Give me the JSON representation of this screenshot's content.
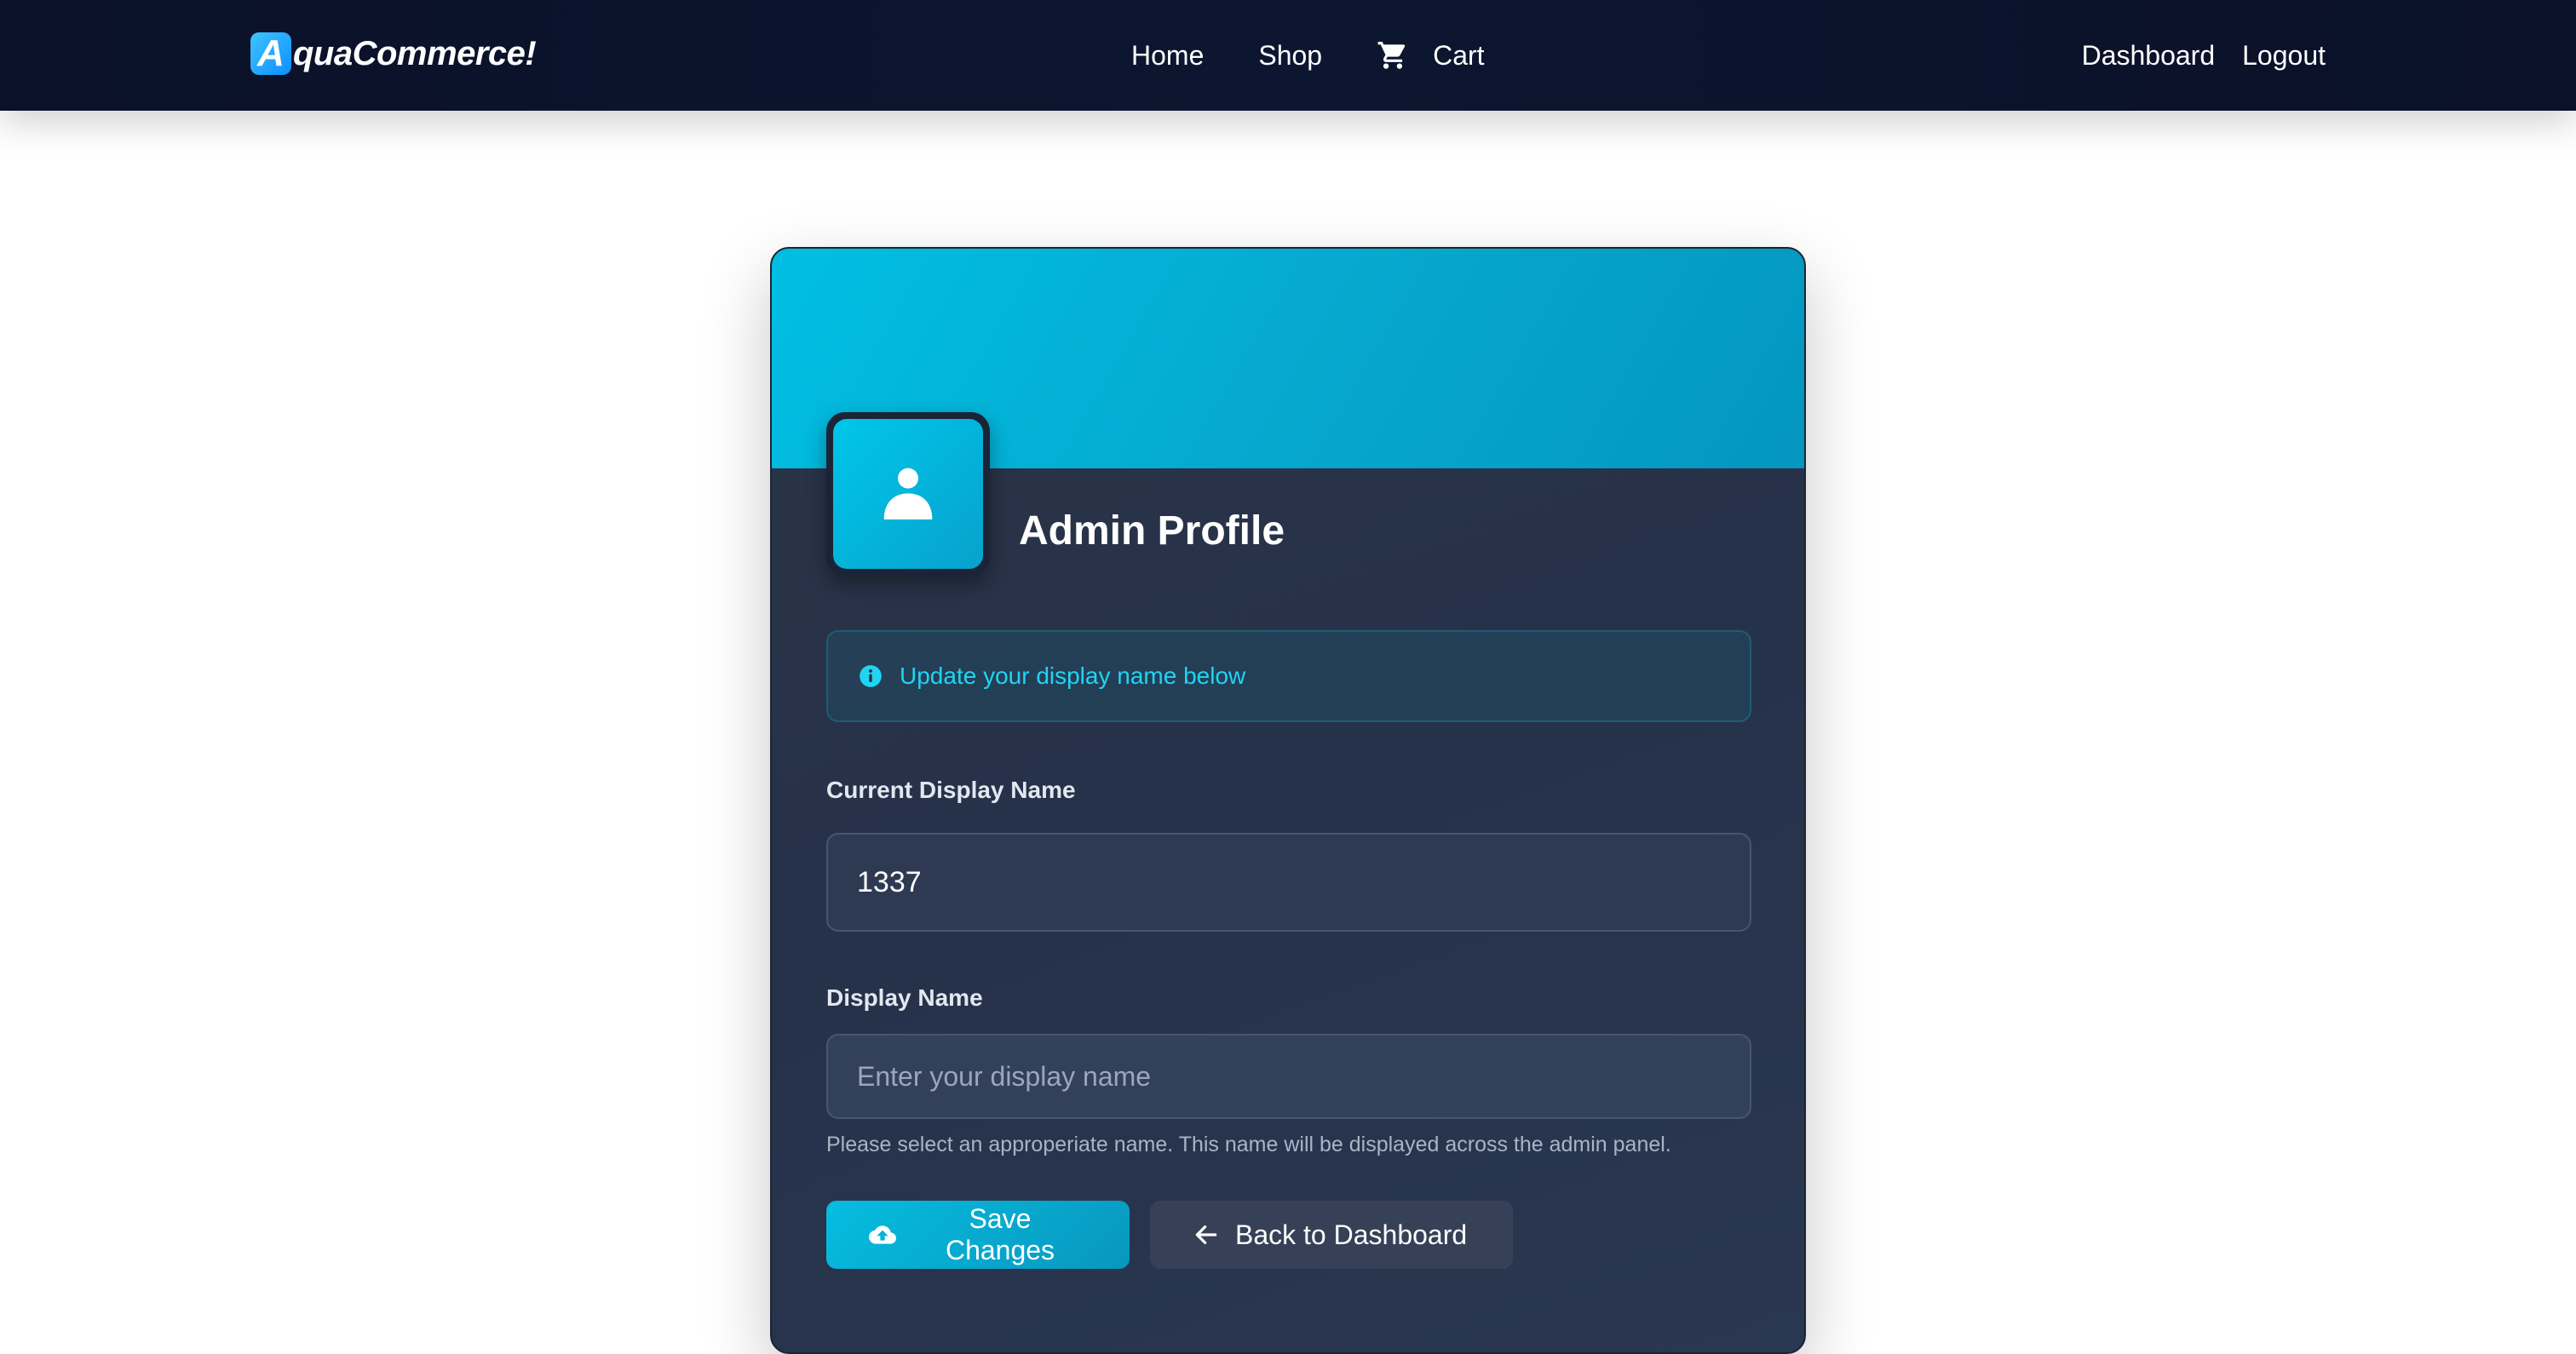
{
  "navbar": {
    "brand_mark": "A",
    "brand_text": "quaCommerce!",
    "links": {
      "home": "Home",
      "shop": "Shop",
      "cart": "Cart",
      "dashboard": "Dashboard",
      "logout": "Logout"
    },
    "icons": {
      "cart": "shopping-cart-icon"
    }
  },
  "profile": {
    "title": "Admin Profile",
    "avatar_icon": "person-icon",
    "alert": {
      "icon": "info-circle-icon",
      "text": "Update your display name below"
    },
    "current_name": {
      "label": "Current Display Name",
      "value": "1337"
    },
    "display_name": {
      "label": "Display Name",
      "placeholder": "Enter your display name",
      "value": "",
      "help": "Please select an approperiate name. This name will be displayed across the admin panel."
    },
    "buttons": {
      "save": "Save Changes",
      "save_icon": "cloud-upload-icon",
      "back": "Back to Dashboard",
      "back_icon": "arrow-left-icon"
    }
  },
  "colors": {
    "navbar_bg": "#0a1128",
    "accent": "#06bde0",
    "card_bg": "#2a3447",
    "alert_text": "#21d4f2"
  }
}
